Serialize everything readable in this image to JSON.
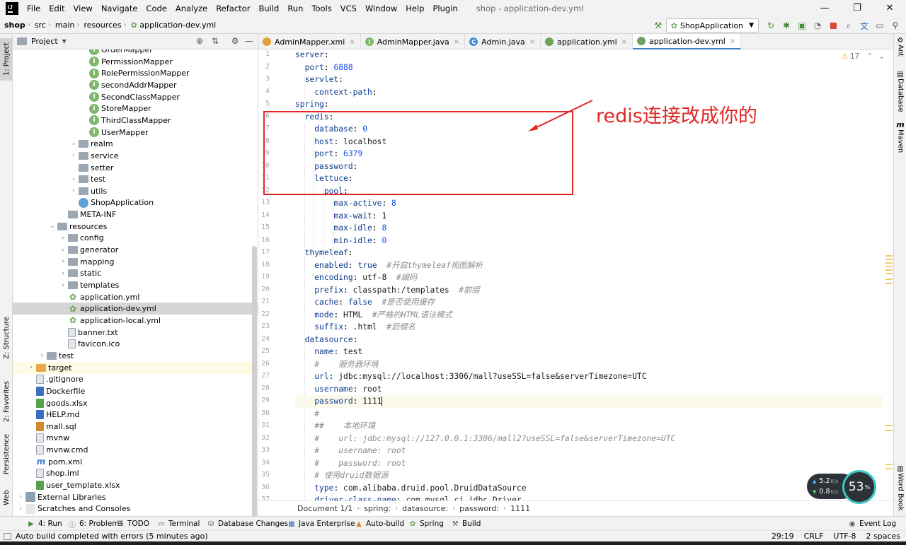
{
  "menubar": {
    "items": [
      "File",
      "Edit",
      "View",
      "Navigate",
      "Code",
      "Analyze",
      "Refactor",
      "Build",
      "Run",
      "Tools",
      "VCS",
      "Window",
      "Help",
      "Plugin"
    ],
    "window_title": "shop - application-dev.yml",
    "window_buttons": [
      "—",
      "❐",
      "✕"
    ]
  },
  "navbar": {
    "crumbs": [
      "shop",
      "src",
      "main",
      "resources",
      "application-dev.yml"
    ],
    "run_config": "ShopApplication"
  },
  "left_strip": {
    "tabs": [
      "1: Project",
      "Z: Structure",
      "2: Favorites",
      "Persistence",
      "Web"
    ]
  },
  "project": {
    "title": "Project",
    "tree": [
      {
        "label": "OrderMapper",
        "icon": "interface-icon",
        "arrow": ""
      },
      {
        "label": "PermissionMapper",
        "icon": "interface-icon",
        "arrow": ""
      },
      {
        "label": "RolePermissionMapper",
        "icon": "interface-icon",
        "arrow": ""
      },
      {
        "label": "secondAddrMapper",
        "icon": "interface-icon",
        "arrow": ""
      },
      {
        "label": "SecondClassMapper",
        "icon": "interface-icon",
        "arrow": ""
      },
      {
        "label": "StoreMapper",
        "icon": "interface-icon",
        "arrow": ""
      },
      {
        "label": "ThirdClassMapper",
        "icon": "interface-icon",
        "arrow": ""
      },
      {
        "label": "UserMapper",
        "icon": "interface-icon",
        "arrow": ""
      },
      {
        "label": "realm",
        "icon": "folder-icon",
        "arrow": "›"
      },
      {
        "label": "service",
        "icon": "folder-icon",
        "arrow": "›"
      },
      {
        "label": "setter",
        "icon": "folder-icon",
        "arrow": ""
      },
      {
        "label": "test",
        "icon": "folder-icon",
        "arrow": "›"
      },
      {
        "label": "utils",
        "icon": "folder-icon",
        "arrow": "›"
      },
      {
        "label": "ShopApplication",
        "icon": "spring-class-icon",
        "arrow": ""
      },
      {
        "label": "META-INF",
        "icon": "folder-icon",
        "arrow": ""
      },
      {
        "label": "resources",
        "icon": "folder-icon",
        "arrow": "⌄"
      },
      {
        "label": "config",
        "icon": "folder-icon",
        "arrow": "›"
      },
      {
        "label": "generator",
        "icon": "folder-icon",
        "arrow": "›"
      },
      {
        "label": "mapping",
        "icon": "folder-icon",
        "arrow": "›"
      },
      {
        "label": "static",
        "icon": "folder-icon",
        "arrow": "›"
      },
      {
        "label": "templates",
        "icon": "folder-icon",
        "arrow": "›"
      },
      {
        "label": "application.yml",
        "icon": "yml-icon",
        "arrow": ""
      },
      {
        "label": "application-dev.yml",
        "icon": "yml-icon",
        "arrow": ""
      },
      {
        "label": "application-local.yml",
        "icon": "yml-icon",
        "arrow": ""
      },
      {
        "label": "banner.txt",
        "icon": "text-file-icon",
        "arrow": ""
      },
      {
        "label": "favicon.ico",
        "icon": "image-file-icon",
        "arrow": ""
      },
      {
        "label": "test",
        "icon": "folder-icon",
        "arrow": "›"
      },
      {
        "label": "target",
        "icon": "folder-orange-icon",
        "arrow": "›"
      },
      {
        "label": ".gitignore",
        "icon": "text-file-icon",
        "arrow": ""
      },
      {
        "label": "Dockerfile",
        "icon": "docker-file-icon",
        "arrow": ""
      },
      {
        "label": "goods.xlsx",
        "icon": "xlsx-file-icon",
        "arrow": ""
      },
      {
        "label": "HELP.md",
        "icon": "markdown-file-icon",
        "arrow": ""
      },
      {
        "label": "mall.sql",
        "icon": "sql-file-icon",
        "arrow": ""
      },
      {
        "label": "mvnw",
        "icon": "text-file-icon",
        "arrow": ""
      },
      {
        "label": "mvnw.cmd",
        "icon": "text-file-icon",
        "arrow": ""
      },
      {
        "label": "pom.xml",
        "icon": "maven-icon",
        "arrow": ""
      },
      {
        "label": "shop.iml",
        "icon": "text-file-icon",
        "arrow": ""
      },
      {
        "label": "user_template.xlsx",
        "icon": "xlsx-file-icon",
        "arrow": ""
      },
      {
        "label": "External Libraries",
        "icon": "library-icon",
        "arrow": "›"
      },
      {
        "label": "Scratches and Consoles",
        "icon": "scratch-icon",
        "arrow": "›"
      }
    ]
  },
  "editor": {
    "tabs": [
      {
        "label": "AdminMapper.xml",
        "icon": "xml-icon",
        "color": "#e0a23c"
      },
      {
        "label": "AdminMapper.java",
        "icon": "interface-icon",
        "color": "#7fb76b"
      },
      {
        "label": "Admin.java",
        "icon": "class-icon",
        "color": "#4a8bd1"
      },
      {
        "label": "application.yml",
        "icon": "yml-icon",
        "color": "#6da35a"
      },
      {
        "label": "application-dev.yml",
        "icon": "yml-icon",
        "color": "#6da35a"
      }
    ],
    "close_glyph": "×",
    "warnings_count": "17",
    "line_numbers": [
      "1",
      "2",
      "3",
      "4",
      "5",
      "6",
      "7",
      "8",
      "9",
      "10",
      "11",
      "12",
      "13",
      "14",
      "15",
      "16",
      "17",
      "18",
      "19",
      "20",
      "21",
      "22",
      "23",
      "24",
      "25",
      "26",
      "27",
      "28",
      "29",
      "30",
      "31",
      "32",
      "33",
      "34",
      "35",
      "36",
      "37"
    ],
    "breadcrumbs": [
      "Document 1/1",
      "spring:",
      "datasource:",
      "password:",
      "1111"
    ]
  },
  "annotation": {
    "text": "redis连接改成你的"
  },
  "right_strip": {
    "tabs": [
      "Ant",
      "Database",
      "Maven",
      "Word Book"
    ]
  },
  "net_widget": {
    "upload": "5.2",
    "download": "0.8",
    "unit": "K/s",
    "percent": "53",
    "percent_sign": "%"
  },
  "bottombar": {
    "tabs": [
      "4: Run",
      "6: Problems",
      "TODO",
      "Terminal",
      "Database Changes",
      "Java Enterprise",
      "Auto-build",
      "Spring",
      "Build"
    ],
    "event_log": "Event Log"
  },
  "statusbar": {
    "message": "Auto build completed with errors (5 minutes ago)",
    "position": "29:19",
    "line_sep": "CRLF",
    "encoding": "UTF-8",
    "indent": "2 spaces"
  },
  "colors": {
    "annotation": "#e22727",
    "key": "#0c3c8e",
    "number": "#1750eb",
    "comment": "#8c8c8c"
  }
}
